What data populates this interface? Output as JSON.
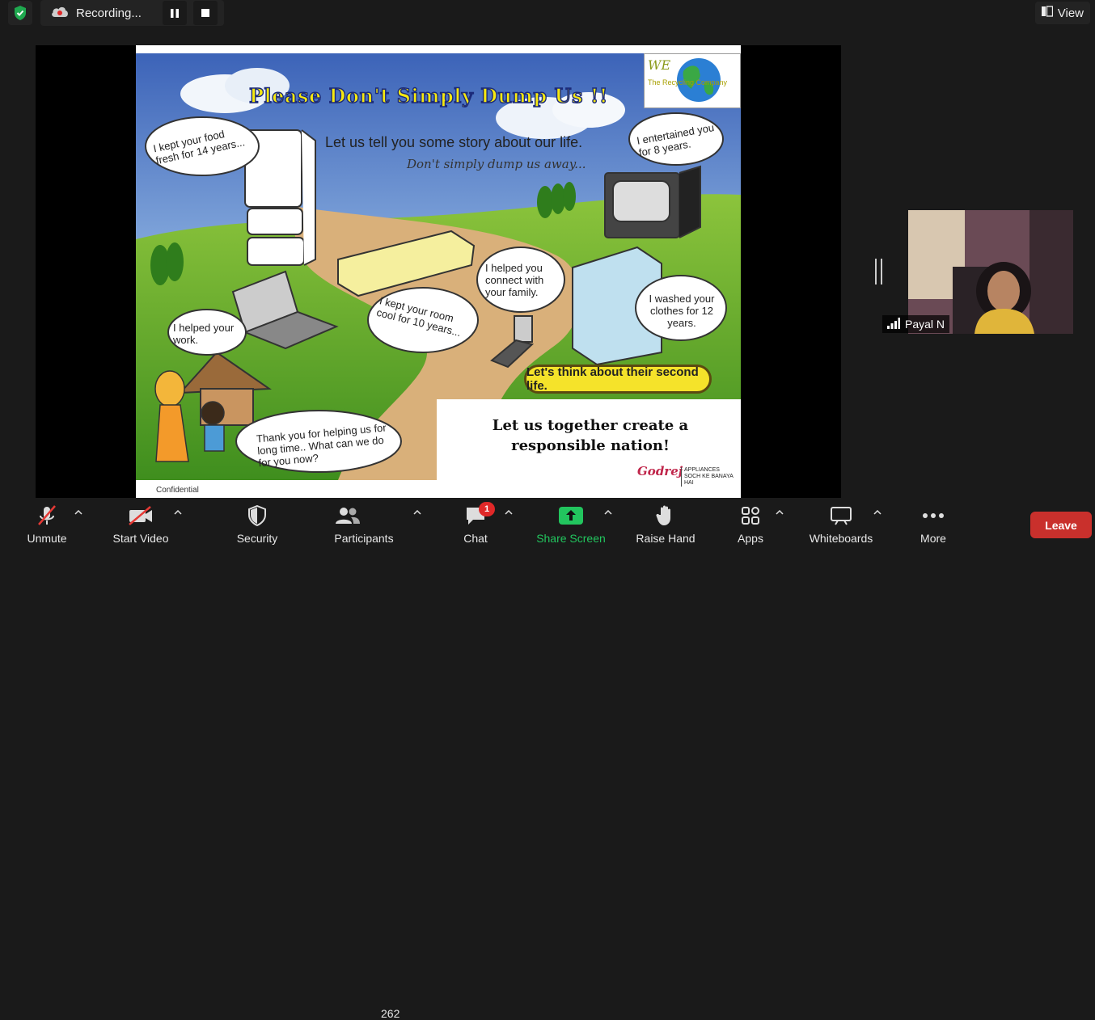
{
  "top": {
    "recording_label": "Recording...",
    "view_label": "View"
  },
  "slide": {
    "title": "Please Don't Simply Dump Us !!",
    "subtitle": "Let us tell you some story about our life.",
    "subtitle2": "Don't simply dump us away...",
    "logo_we": "WE",
    "logo_tagline": "The Recycling Company",
    "bubbles": {
      "fridge": "I kept your food fresh for 14 years...",
      "tv": "I entertained you for 8 years.",
      "phone": "I helped you connect with your  family.",
      "ac": "I kept your room cool for 10 years...",
      "washer": "I washed your clothes for 12 years.",
      "laptop": "I helped your work.",
      "family": "Thank you for helping us for long time.. What can we do for you now?"
    },
    "second_life": "Let's think about their second life.",
    "nation": "Let us together create a responsible nation!",
    "godrej": "Godrej",
    "appliances": "APPLIANCES",
    "appliances_tag": "SOCH KE BANAYA HAI",
    "confidential": "Confidential"
  },
  "participant": {
    "name": "Payal N"
  },
  "toolbar": {
    "unmute": "Unmute",
    "start_video": "Start Video",
    "security": "Security",
    "participants": "Participants",
    "participants_count": "262",
    "chat": "Chat",
    "chat_badge": "1",
    "share_screen": "Share Screen",
    "raise_hand": "Raise Hand",
    "apps": "Apps",
    "whiteboards": "Whiteboards",
    "more": "More",
    "leave": "Leave"
  },
  "colors": {
    "leave": "#c9302c",
    "share": "#22c55e",
    "badge": "#e02828"
  }
}
